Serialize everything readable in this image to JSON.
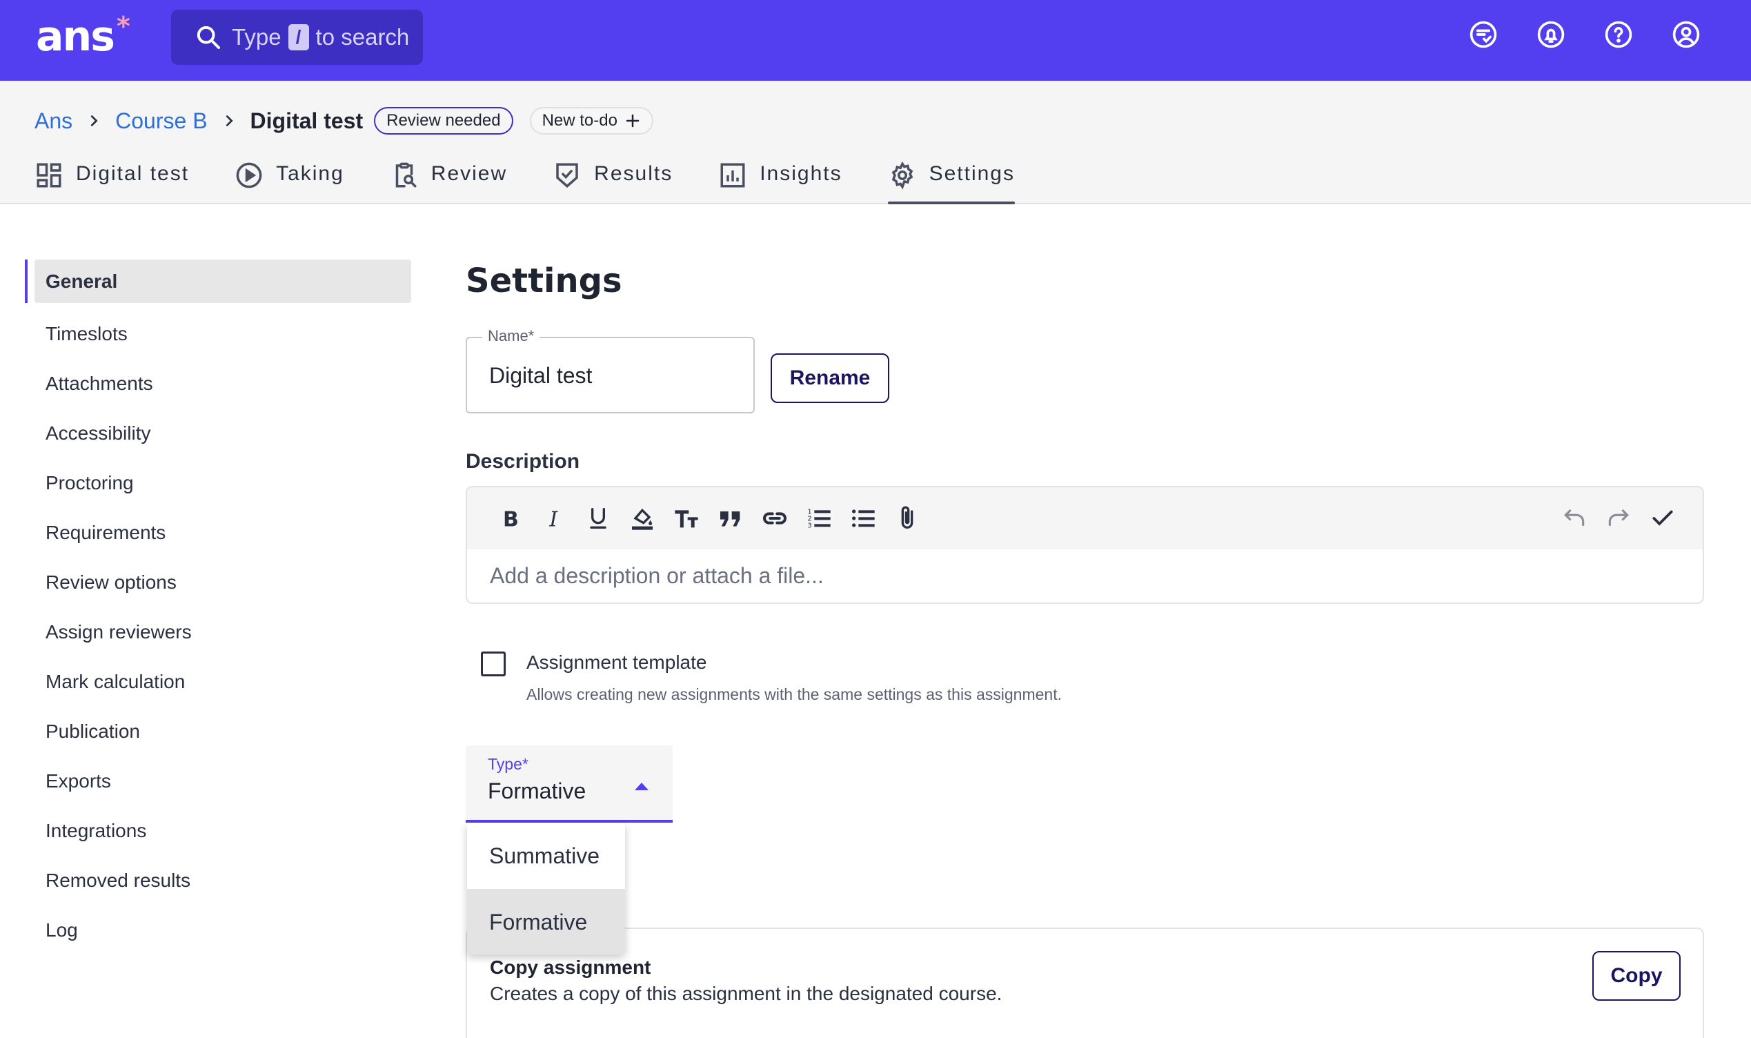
{
  "topbar": {
    "logo_text": "ans",
    "logo_mark": "*",
    "search": {
      "prefix": "Type",
      "key": "/",
      "suffix": "to search",
      "icon": "search-icon"
    },
    "icons": [
      "feedback-icon",
      "notifications-icon",
      "help-icon",
      "account-icon"
    ]
  },
  "breadcrumb": {
    "items": [
      "Ans",
      "Course B"
    ],
    "current": "Digital test",
    "badge": "Review needed",
    "todo": "New to-do"
  },
  "tabs": [
    {
      "label": "Digital test",
      "icon": "dashboard-icon"
    },
    {
      "label": "Taking",
      "icon": "play-icon"
    },
    {
      "label": "Review",
      "icon": "clipboard-search-icon"
    },
    {
      "label": "Results",
      "icon": "shield-check-icon"
    },
    {
      "label": "Insights",
      "icon": "bar-chart-icon"
    },
    {
      "label": "Settings",
      "icon": "gear-icon",
      "active": true
    }
  ],
  "sidebar": {
    "items": [
      "General",
      "Timeslots",
      "Attachments",
      "Accessibility",
      "Proctoring",
      "Requirements",
      "Review options",
      "Assign reviewers",
      "Mark calculation",
      "Publication",
      "Exports",
      "Integrations",
      "Removed results",
      "Log"
    ],
    "active": "General"
  },
  "main": {
    "title": "Settings",
    "name_field": {
      "label": "Name*",
      "value": "Digital test"
    },
    "rename_label": "Rename",
    "description": {
      "label": "Description",
      "placeholder": "Add a description or attach a file...",
      "toolbar": [
        "bold-icon",
        "italic-icon",
        "underline-icon",
        "highlight-icon",
        "text-size-icon",
        "quote-icon",
        "link-icon",
        "numbered-list-icon",
        "bullet-list-icon",
        "attachment-icon"
      ],
      "toolbar_right": [
        "undo-icon",
        "redo-icon",
        "check-icon"
      ]
    },
    "template": {
      "label": "Assignment template",
      "description": "Allows creating new assignments with the same settings as this assignment.",
      "checked": false
    },
    "type_field": {
      "label": "Type*",
      "value": "Formative",
      "options": [
        "Summative",
        "Formative"
      ],
      "selected": "Formative"
    },
    "copy": {
      "title": "Copy assignment",
      "description": "Creates a copy of this assignment in the designated course.",
      "button": "Copy"
    }
  },
  "colors": {
    "brand": "#533ff0",
    "link": "#2f6fd6",
    "button_border": "#1a1560"
  }
}
